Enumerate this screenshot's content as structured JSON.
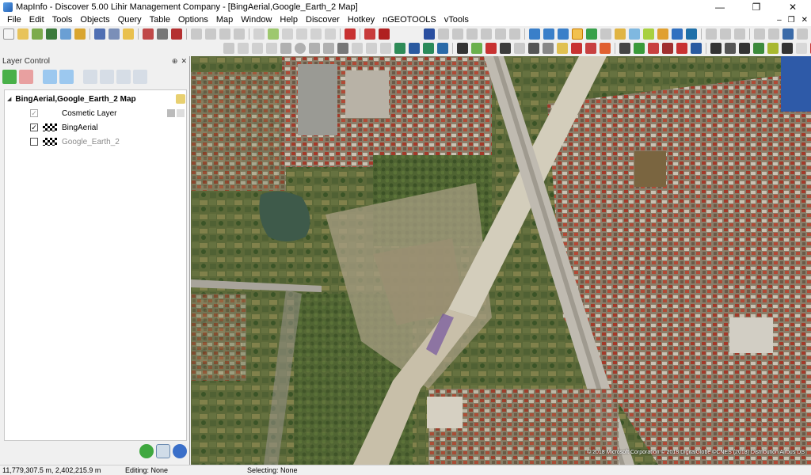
{
  "window": {
    "title": "MapInfo - Discover 5.00   Lihir Management Company - [BingAerial,Google_Earth_2 Map]",
    "minimize": "—",
    "maximize": "❐",
    "close": "✕"
  },
  "menu": [
    "File",
    "Edit",
    "Tools",
    "Objects",
    "Query",
    "Table",
    "Options",
    "Map",
    "Window",
    "Help",
    "Discover",
    "Hotkey",
    "nGEOTOOLS",
    "vTools"
  ],
  "mdi_controls": {
    "minimize": "–",
    "restore": "❐",
    "close": "✕"
  },
  "layer_control": {
    "title": "Layer Control",
    "pin_icon": "⊕",
    "close_icon": "✕",
    "map_name": "BingAerial,Google_Earth_2 Map",
    "layers": [
      {
        "name": "Cosmetic Layer",
        "checked": true,
        "disabled": true
      },
      {
        "name": "BingAerial",
        "checked": true,
        "disabled": false
      },
      {
        "name": "Google_Earth_2",
        "checked": false,
        "disabled": false
      }
    ]
  },
  "map": {
    "attribution": "© 2018 Microsoft Corporation © 2018 DigitalGlobe ©CNES (2018) Distribution Airbus DS"
  },
  "status": {
    "coords": "11,779,307.5 m, 2,402,215.9 m",
    "editing": "Editing: None",
    "selecting": "Selecting: None"
  },
  "colors": {
    "map_vegetation": "#5d6b3e",
    "map_urban": "#8a7e6a",
    "map_road": "#bfbab0"
  }
}
